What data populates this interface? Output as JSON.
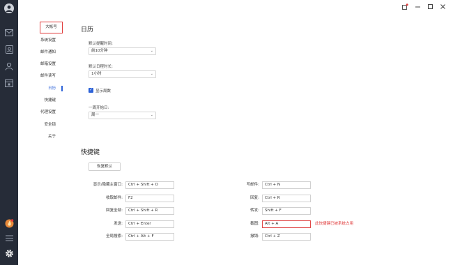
{
  "window_controls": {
    "pin": "↗",
    "minimize": "−",
    "maximize": "□",
    "close": "✕"
  },
  "rail": {
    "icons": [
      "avatar-icon",
      "mail-icon",
      "contacts-card-icon",
      "person-icon",
      "calendar-icon",
      "fire-badge-icon",
      "menu-icon",
      "settings-gear-icon"
    ]
  },
  "nav": {
    "items": [
      "大帐号",
      "系统设置",
      "邮件通知",
      "邮箱设置",
      "邮件读写",
      "日历",
      "快捷键",
      "代理设置",
      "安全锁",
      "关于"
    ],
    "active_index": 5
  },
  "calendar": {
    "title": "日历",
    "reminder_label": "默认提醒时间:",
    "reminder_value": "前10分钟",
    "duration_label": "默认日程时长:",
    "duration_value": "1小时",
    "show_weeks_label": "显示周数",
    "show_weeks_checked": true,
    "week_start_label": "一周开始日:",
    "week_start_value": "周一"
  },
  "shortcuts": {
    "title": "快捷键",
    "restore_button": "恢复默认",
    "left": [
      {
        "label": "显示/隐藏主窗口:",
        "value": "Ctrl + Shift + O"
      },
      {
        "label": "收取邮件:",
        "value": "F2"
      },
      {
        "label": "回复全部:",
        "value": "Ctrl + Shift + R"
      },
      {
        "label": "发送:",
        "value": "Ctrl + Enter"
      },
      {
        "label": "全局搜索:",
        "value": "Ctrl + Alt + F"
      }
    ],
    "right": [
      {
        "label": "写邮件:",
        "value": "Ctrl + N"
      },
      {
        "label": "回复:",
        "value": "Ctrl + R"
      },
      {
        "label": "转发:",
        "value": "Shift + F"
      },
      {
        "label": "截图:",
        "value": "Alt + A"
      },
      {
        "label": "撤销:",
        "value": "Ctrl + Z"
      }
    ],
    "conflict_message": "此快捷键已被系统占用"
  },
  "colors": {
    "rail": "#262c38",
    "accent": "#2d63d8",
    "error": "#e03a3a"
  }
}
